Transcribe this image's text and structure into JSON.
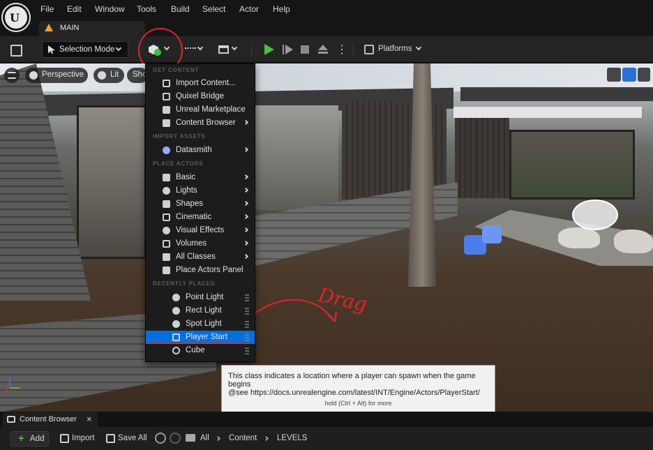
{
  "menubar": {
    "items": [
      "File",
      "Edit",
      "Window",
      "Tools",
      "Build",
      "Select",
      "Actor",
      "Help"
    ]
  },
  "level_tab": {
    "label": "MAIN"
  },
  "toolbar": {
    "selection_mode": "Selection Mode",
    "platforms": "Platforms"
  },
  "viewport": {
    "perspective": "Perspective",
    "lit": "Lit",
    "show": "Sho"
  },
  "add_menu": {
    "section_get_content": "GET CONTENT",
    "get_content": [
      "Import Content...",
      "Quixel Bridge",
      "Unreal Marketplace",
      "Content Browser"
    ],
    "section_import_assets": "IMPORT ASSETS",
    "import_assets": [
      "Datasmith"
    ],
    "section_place_actors": "PLACE ACTORS",
    "place_actors": [
      "Basic",
      "Lights",
      "Shapes",
      "Cinematic",
      "Visual Effects",
      "Volumes",
      "All Classes",
      "Place Actors Panel"
    ],
    "section_recently_placed": "RECENTLY PLACED",
    "recently_placed": [
      "Point Light",
      "Rect Light",
      "Spot Light",
      "Player Start",
      "Cube"
    ]
  },
  "annotation": {
    "handwritten": "Drag"
  },
  "tooltip": {
    "line1": "This class indicates a location where a player can spawn when the game begins",
    "line2": "@see https://docs.unrealengine.com/latest/INT/Engine/Actors/PlayerStart/",
    "line3": "hold (Ctrl + Alt) for more"
  },
  "content_browser": {
    "tab": "Content Browser",
    "close": "×",
    "add": "Add",
    "import": "Import",
    "save_all": "Save All",
    "breadcrumbs": [
      "All",
      "Content",
      "LEVELS"
    ]
  },
  "colors": {
    "accent_highlight": "#0070e0",
    "annotation_red": "#e0242b",
    "play_green": "#4bbf3b"
  }
}
